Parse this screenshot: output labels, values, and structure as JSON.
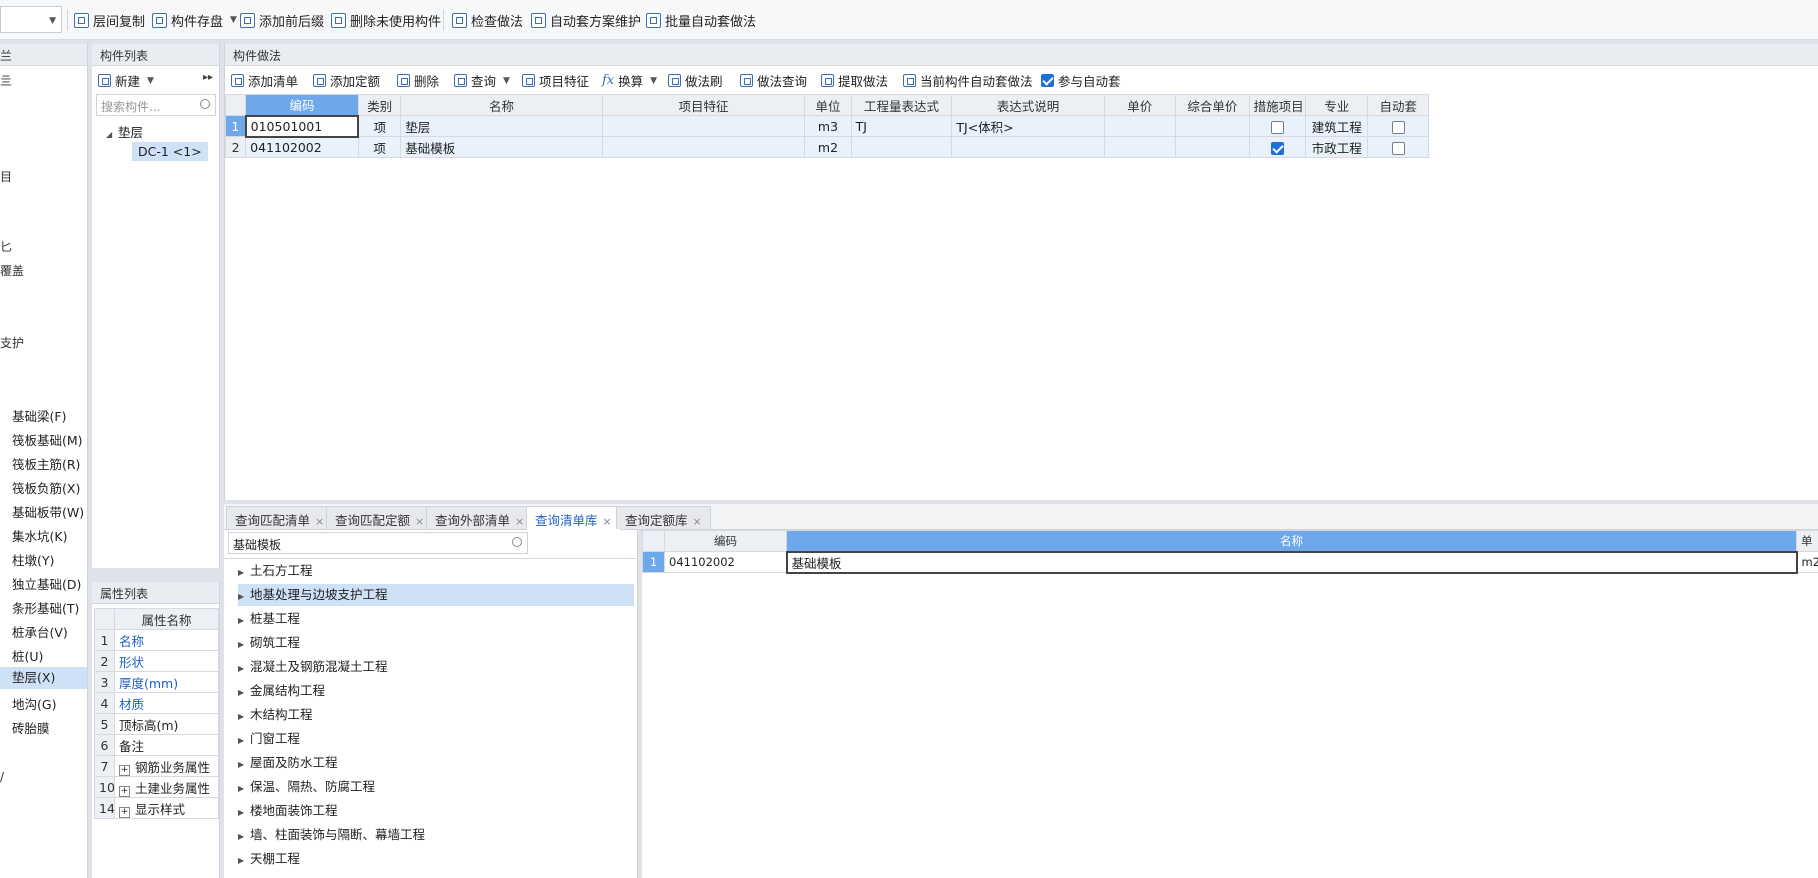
{
  "toolbar": {
    "buttons": [
      {
        "label": "层间复制",
        "icon": "copy-layers-icon"
      },
      {
        "label": "构件存盘",
        "icon": "save-component-icon"
      },
      {
        "label": "添加前后缀",
        "icon": "add-prefix-suffix-icon"
      },
      {
        "label": "删除未使用构件",
        "icon": "delete-unused-icon"
      },
      {
        "label": "检查做法",
        "icon": "check-method-icon"
      },
      {
        "label": "自动套方案维护",
        "icon": "auto-scheme-icon"
      },
      {
        "label": "批量自动套做法",
        "icon": "batch-auto-icon"
      }
    ]
  },
  "left_nav": {
    "fragments": [
      "兰",
      "亖",
      "目",
      "匕",
      "覆盖",
      "支护",
      "/"
    ],
    "items": [
      "基础梁(F)",
      "筏板基础(M)",
      "筏板主筋(R)",
      "筏板负筋(X)",
      "基础板带(W)",
      "集水坑(K)",
      "柱墩(Y)",
      "独立基础(D)",
      "条形基础(T)",
      "桩承台(V)",
      "桩(U)",
      "垫层(X)",
      "地沟(G)",
      "砖胎膜"
    ],
    "selected_index": 11
  },
  "component_list": {
    "title": "构件列表",
    "new_label": "新建",
    "more_label": "▸▸",
    "search_placeholder": "搜索构件...",
    "tree_parent": "垫层",
    "tree_child": "DC-1 <1>"
  },
  "property_list": {
    "title": "属性列表",
    "header": "属性名称",
    "rows": [
      {
        "num": "1",
        "name": "名称",
        "blue": true
      },
      {
        "num": "2",
        "name": "形状",
        "blue": true
      },
      {
        "num": "3",
        "name": "厚度(mm)",
        "blue": true
      },
      {
        "num": "4",
        "name": "材质",
        "blue": true
      },
      {
        "num": "5",
        "name": "顶标高(m)",
        "blue": false
      },
      {
        "num": "6",
        "name": "备注",
        "blue": false
      },
      {
        "num": "7",
        "name": "钢筋业务属性",
        "blue": false,
        "expand": true
      },
      {
        "num": "10",
        "name": "土建业务属性",
        "blue": false,
        "expand": true
      },
      {
        "num": "14",
        "name": "显示样式",
        "blue": false,
        "expand": true
      }
    ]
  },
  "main": {
    "title": "构件做法",
    "buttons": [
      {
        "label": "添加清单",
        "icon": "add-list-icon"
      },
      {
        "label": "添加定额",
        "icon": "add-quota-icon"
      },
      {
        "label": "删除",
        "icon": "delete-icon"
      },
      {
        "label": "查询",
        "icon": "query-icon",
        "dropdown": true
      },
      {
        "label": "项目特征",
        "icon": "project-feature-icon"
      },
      {
        "label": "换算",
        "icon": "fx-icon",
        "dropdown": true
      },
      {
        "label": "做法刷",
        "icon": "method-brush-icon"
      },
      {
        "label": "做法查询",
        "icon": "method-query-icon"
      },
      {
        "label": "提取做法",
        "icon": "extract-method-icon"
      },
      {
        "label": "当前构件自动套做法",
        "icon": "auto-apply-icon"
      }
    ],
    "auto_checkbox_label": "参与自动套",
    "columns": [
      "编码",
      "类别",
      "名称",
      "项目特征",
      "单位",
      "工程量表达式",
      "表达式说明",
      "单价",
      "综合单价",
      "措施项目",
      "专业",
      "自动套"
    ],
    "rows": [
      {
        "num": "1",
        "code": "010501001",
        "type": "项",
        "name": "垫层",
        "feature": "",
        "unit": "m3",
        "expr": "TJ",
        "expr_desc": "TJ<体积>",
        "price": "",
        "total_price": "",
        "measure": false,
        "major": "建筑工程",
        "auto": false
      },
      {
        "num": "2",
        "code": "041102002",
        "type": "项",
        "name": "基础模板",
        "feature": "",
        "unit": "m2",
        "expr": "",
        "expr_desc": "",
        "price": "",
        "total_price": "",
        "measure": true,
        "major": "市政工程",
        "auto": false
      }
    ]
  },
  "bottom_tabs": [
    {
      "label": "查询匹配清单",
      "active": false
    },
    {
      "label": "查询匹配定额",
      "active": false
    },
    {
      "label": "查询外部清单",
      "active": false
    },
    {
      "label": "查询清单库",
      "active": true
    },
    {
      "label": "查询定额库",
      "active": false
    }
  ],
  "query": {
    "search_value": "基础模板",
    "tree": [
      "土石方工程",
      "地基处理与边坡支护工程",
      "桩基工程",
      "砌筑工程",
      "混凝土及钢筋混凝土工程",
      "金属结构工程",
      "木结构工程",
      "门窗工程",
      "屋面及防水工程",
      "保温、隔热、防腐工程",
      "楼地面装饰工程",
      "墙、柱面装饰与隔断、幕墙工程",
      "天棚工程"
    ],
    "tree_selected": 1,
    "result_columns": [
      "编码",
      "名称",
      "单"
    ],
    "results": [
      {
        "num": "1",
        "code": "041102002",
        "name": "基础模板",
        "unit": "m2"
      }
    ]
  }
}
